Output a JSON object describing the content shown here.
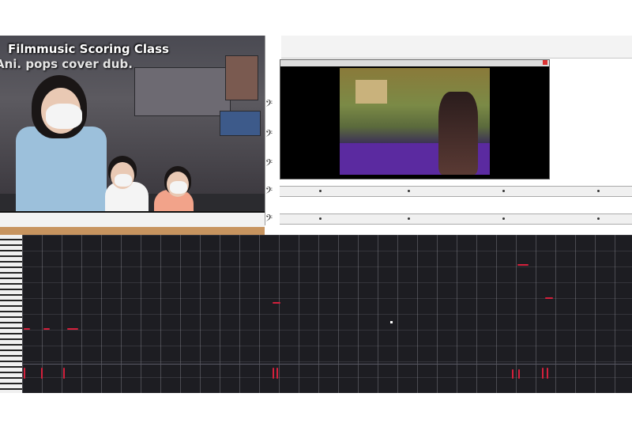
{
  "video_overlay": {
    "title": "Filmmusic Scoring Class",
    "subtitle": "Ani. pops cover dub."
  },
  "score_window": {
    "clef_symbol": "𝄢",
    "staff_count": 6
  },
  "colors": {
    "note_color": "#d4203c",
    "roll_background": "#1d1d22",
    "video_floor": "#5b2aa0"
  }
}
